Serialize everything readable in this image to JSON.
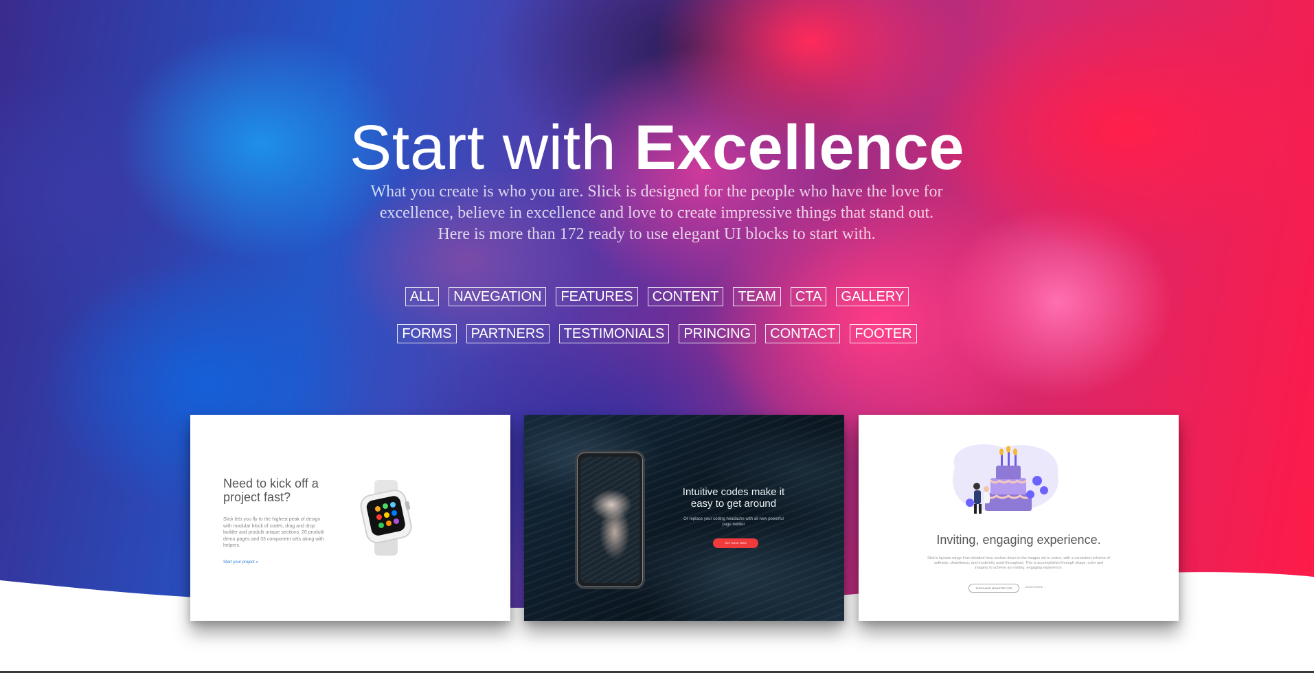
{
  "hero": {
    "title_light": "Start with",
    "title_bold": "Excellence",
    "lead_lines": [
      "What you create is who you are. Slick is designed for the people who have the love for",
      "excellence, believe in excellence and love to create impressive things that stand out.",
      "Here is more than 172 ready to use elegant UI blocks to start with."
    ]
  },
  "filters": {
    "row1": [
      "ALL",
      "NAVEGATION",
      "FEATURES",
      "CONTENT",
      "TEAM",
      "CTA",
      "GALLERY"
    ],
    "row2": [
      "FORMS",
      "PARTNERS",
      "TESTIMONIALS",
      "PRINCING",
      "CONTACT",
      "FOOTER"
    ]
  },
  "cards": {
    "card1": {
      "heading": "Need to kick off a project fast?",
      "body": "Slick lets you fly to the highest peak of design with modular block of codes, drag and drop builder and produlti unique sections, 20 produlti demo pages and 33 component sets along with helpers.",
      "link": "Start your project  »",
      "icon": "smartwatch-icon"
    },
    "card2": {
      "heading": "Intuitive codes make it easy to get around",
      "sub": "Or replace your coding headache with all new powerful page builder",
      "button": "GET SLICK NOW",
      "accent": "#ef3b3b",
      "icon": "phone-mockup"
    },
    "card3": {
      "heading": "Inviting, engaging experience.",
      "body": "Slick's layouts range from detailed hero section down to the images set to entice, with a consistent scheme of softness, cleanliness, and modernity used throughout. This is accomplished through shape, color and imagery to achieve an inviting, engaging experience.",
      "button": "PURCHASE MONSTER CSS",
      "link": "LEARN MORE  →",
      "icon": "birthday-cake-illustration"
    }
  },
  "colors": {
    "hero_left": "#2456c8",
    "hero_right": "#ff1a46",
    "white": "#ffffff"
  }
}
